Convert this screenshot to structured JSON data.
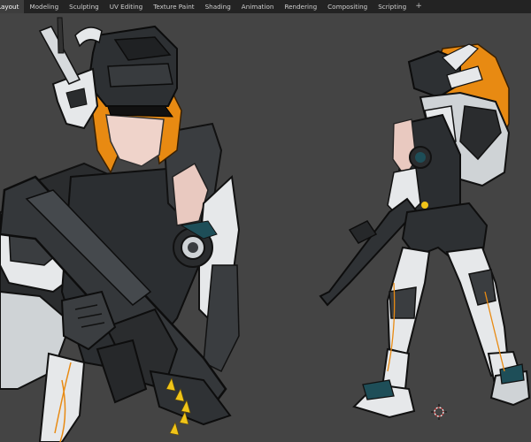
{
  "workspace_tabs": [
    {
      "label": "Layout",
      "active": true
    },
    {
      "label": "Modeling",
      "active": false
    },
    {
      "label": "Sculpting",
      "active": false
    },
    {
      "label": "UV Editing",
      "active": false
    },
    {
      "label": "Texture Paint",
      "active": false
    },
    {
      "label": "Shading",
      "active": false
    },
    {
      "label": "Animation",
      "active": false
    },
    {
      "label": "Rendering",
      "active": false
    },
    {
      "label": "Compositing",
      "active": false
    },
    {
      "label": "Scripting",
      "active": false
    }
  ],
  "add_workspace_label": "+",
  "colors": {
    "viewport_bg": "#444444",
    "header_bg": "#232323",
    "active_tab_bg": "#3d3d3d",
    "armor_dark": "#2a2c2e",
    "armor_mid": "#3a3d40",
    "armor_light": "#e6e8ea",
    "hair_orange": "#e88a12",
    "teal_accent": "#1e4e58",
    "skin": "#e9c9c0",
    "cursor_red": "#d83a3a"
  },
  "icons": [
    "3d-cursor-icon",
    "add-workspace-icon"
  ]
}
